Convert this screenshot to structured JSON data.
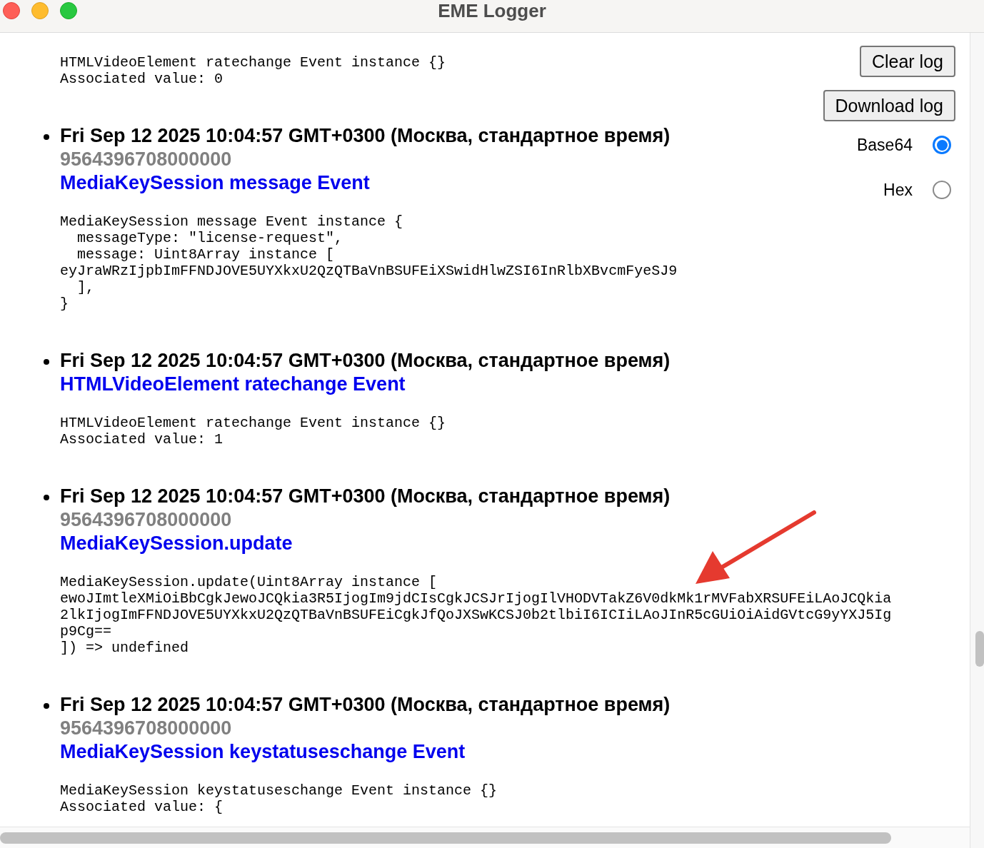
{
  "window": {
    "title": "EME Logger"
  },
  "controls": {
    "buttons": [
      "Clear log",
      "Download log"
    ],
    "encoding": [
      {
        "label": "Base64",
        "selected": true
      },
      {
        "label": "Hex",
        "selected": false
      }
    ]
  },
  "log": [
    {
      "details": "HTMLVideoElement ratechange Event instance {}\nAssociated value: 0"
    },
    {
      "timestamp": "Fri Sep 12 2025 10:04:57 GMT+0300 (Москва, стандартное время)",
      "session_id": "9564396708000000",
      "title": "MediaKeySession message Event",
      "details": "MediaKeySession message Event instance {\n  messageType: \"license-request\",\n  message: Uint8Array instance [\neyJraWRzIjpbImFFNDJOVE5UYXkxU2QzQTBaVnBSUFEiXSwidHlwZSI6InRlbXBvcmFyeSJ9\n  ],\n}"
    },
    {
      "timestamp": "Fri Sep 12 2025 10:04:57 GMT+0300 (Москва, стандартное время)",
      "title": "HTMLVideoElement ratechange Event",
      "details": "HTMLVideoElement ratechange Event instance {}\nAssociated value: 1"
    },
    {
      "timestamp": "Fri Sep 12 2025 10:04:57 GMT+0300 (Москва, стандартное время)",
      "session_id": "9564396708000000",
      "title": "MediaKeySession.update",
      "details": "MediaKeySession.update(Uint8Array instance [\newoJImtleXMiOiBbCgkJewoJCQkia3R5IjogIm9jdCIsCgkJCSJrIjogIlVHODVTakZ6V0dkMk1rMVFabXRSUFEiLAoJCQkia\n2lkIjogImFFNDJOVE5UYXkxU2QzQTBaVnBSUFEiCgkJfQoJXSwKCSJ0b2tlbiI6ICIiLAoJInR5cGUiOiAidGVtcG9yYXJ5Ig\np9Cg==\n]) => undefined"
    },
    {
      "timestamp": "Fri Sep 12 2025 10:04:57 GMT+0300 (Москва, стандартное время)",
      "session_id": "9564396708000000",
      "title": "MediaKeySession keystatuseschange Event",
      "details": "MediaKeySession keystatuseschange Event instance {}\nAssociated value: {"
    }
  ]
}
